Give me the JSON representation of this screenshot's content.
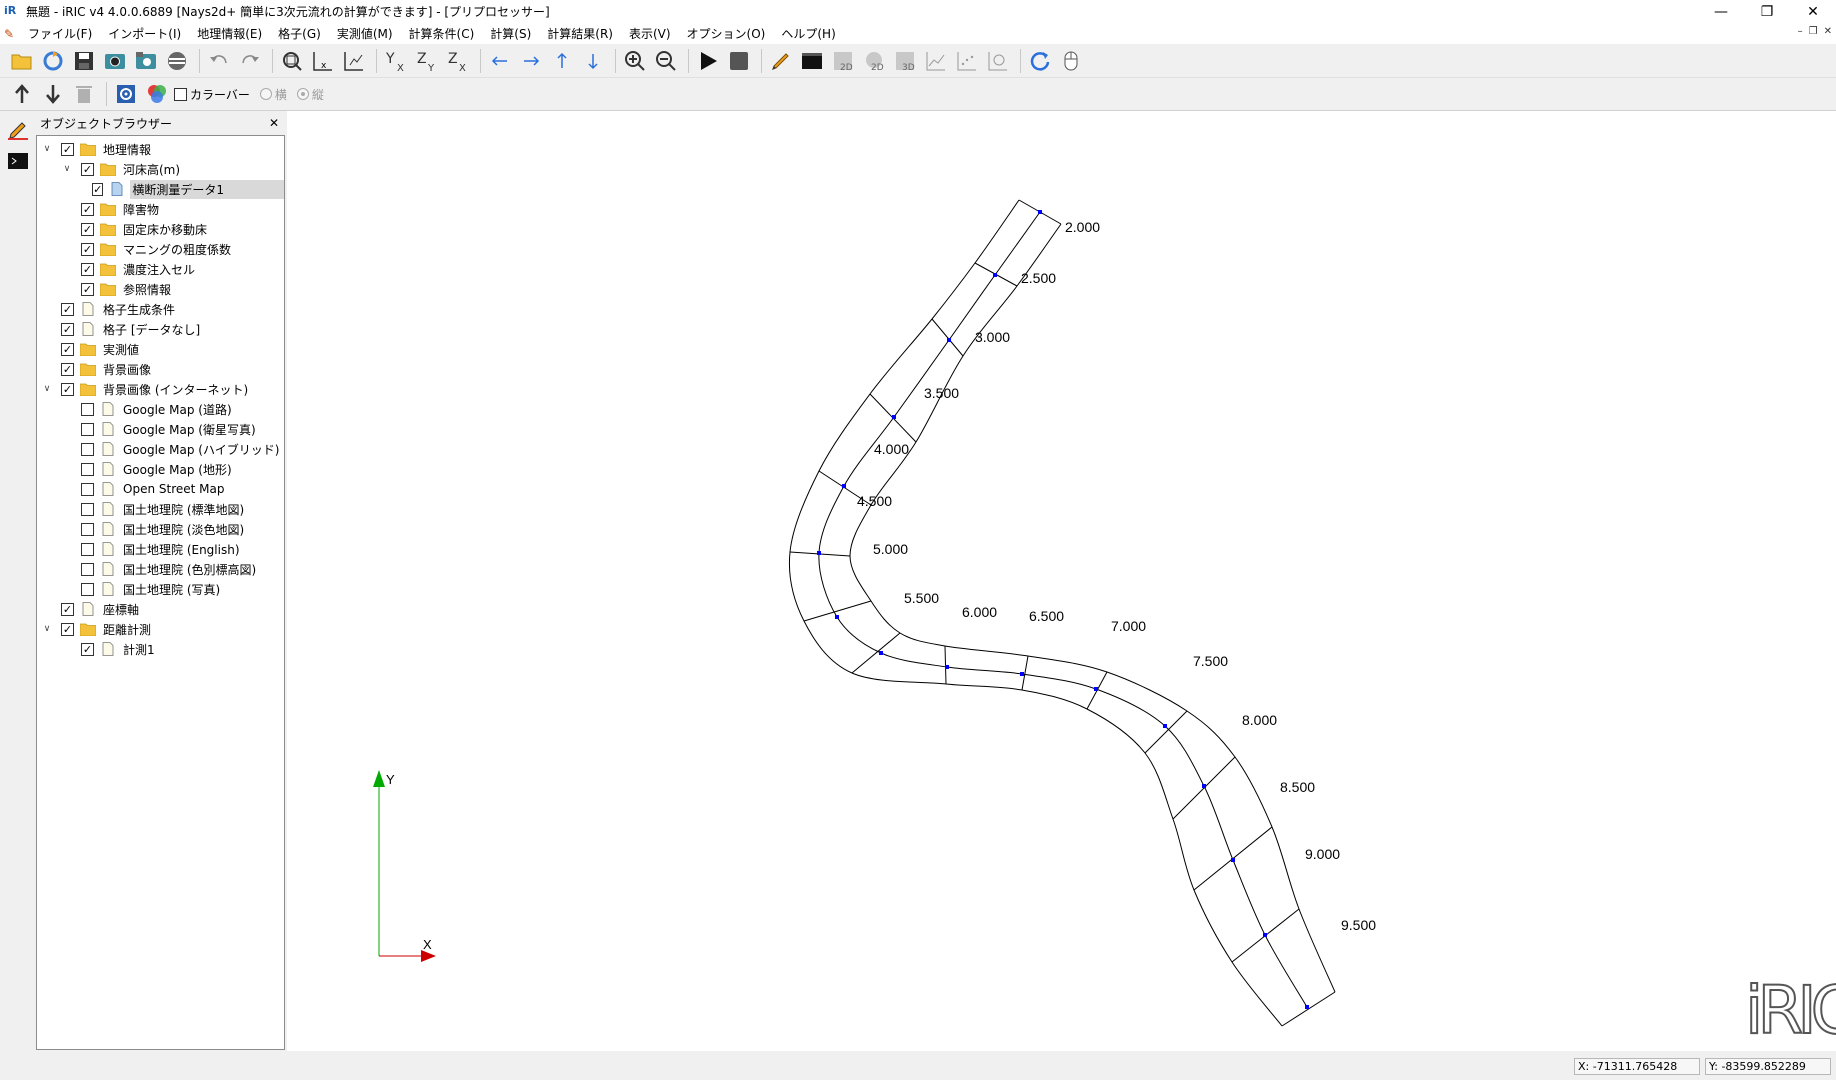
{
  "window": {
    "title": "無題 - iRIC v4 4.0.0.6889 [Nays2d+ 簡単に3次元流れの計算ができます] - [プリプロセッサー]",
    "app_icon_text": "iR"
  },
  "menu": {
    "items": [
      "ファイル(F)",
      "インポート(I)",
      "地理情報(E)",
      "格子(G)",
      "実測値(M)",
      "計算条件(C)",
      "計算(S)",
      "計算結果(R)",
      "表示(V)",
      "オプション(O)",
      "ヘルプ(H)"
    ]
  },
  "toolbar2": {
    "colorbar_label": "カラーバー",
    "horizontal_label": "横",
    "vertical_label": "縦"
  },
  "object_browser": {
    "title": "オブジェクトブラウザー",
    "items": [
      {
        "label": "地理情報",
        "level": 0,
        "expanded": true,
        "checked": true,
        "icon": "folder-icon"
      },
      {
        "label": "河床高(m)",
        "level": 1,
        "expanded": true,
        "checked": true,
        "icon": "folder-icon"
      },
      {
        "label": "横断測量データ1",
        "level": 2,
        "checked": true,
        "icon": "data-file-icon",
        "selected": true
      },
      {
        "label": "障害物",
        "level": 1,
        "checked": true,
        "icon": "folder-icon"
      },
      {
        "label": "固定床か移動床",
        "level": 1,
        "checked": true,
        "icon": "folder-icon"
      },
      {
        "label": "マニングの粗度係数",
        "level": 1,
        "checked": true,
        "icon": "folder-icon"
      },
      {
        "label": "濃度注入セル",
        "level": 1,
        "checked": true,
        "icon": "folder-icon"
      },
      {
        "label": "参照情報",
        "level": 1,
        "checked": true,
        "icon": "folder-icon"
      },
      {
        "label": "格子生成条件",
        "level": 0,
        "checked": true,
        "icon": "file-icon"
      },
      {
        "label": "格子 [データなし]",
        "level": 0,
        "checked": true,
        "icon": "file-icon"
      },
      {
        "label": "実測値",
        "level": 0,
        "checked": true,
        "icon": "folder-icon"
      },
      {
        "label": "背景画像",
        "level": 0,
        "checked": true,
        "icon": "folder-icon"
      },
      {
        "label": "背景画像 (インターネット)",
        "level": 0,
        "expanded": true,
        "checked": true,
        "icon": "folder-icon"
      },
      {
        "label": "Google Map (道路)",
        "level": 1,
        "checked": false,
        "icon": "file-icon"
      },
      {
        "label": "Google Map (衛星写真)",
        "level": 1,
        "checked": false,
        "icon": "file-icon"
      },
      {
        "label": "Google Map (ハイブリッド)",
        "level": 1,
        "checked": false,
        "icon": "file-icon"
      },
      {
        "label": "Google Map (地形)",
        "level": 1,
        "checked": false,
        "icon": "file-icon"
      },
      {
        "label": "Open Street Map",
        "level": 1,
        "checked": false,
        "icon": "file-icon"
      },
      {
        "label": "国土地理院 (標準地図)",
        "level": 1,
        "checked": false,
        "icon": "file-icon"
      },
      {
        "label": "国土地理院 (淡色地図)",
        "level": 1,
        "checked": false,
        "icon": "file-icon"
      },
      {
        "label": "国土地理院 (English)",
        "level": 1,
        "checked": false,
        "icon": "file-icon"
      },
      {
        "label": "国土地理院 (色別標高図)",
        "level": 1,
        "checked": false,
        "icon": "file-icon"
      },
      {
        "label": "国土地理院 (写真)",
        "level": 1,
        "checked": false,
        "icon": "file-icon"
      },
      {
        "label": "座標軸",
        "level": 0,
        "checked": true,
        "icon": "file-icon"
      },
      {
        "label": "距離計測",
        "level": 0,
        "expanded": true,
        "checked": true,
        "icon": "folder-icon"
      },
      {
        "label": "計測1",
        "level": 1,
        "checked": true,
        "icon": "file-icon"
      }
    ]
  },
  "canvas": {
    "cross_section_labels": [
      "2.000",
      "2.500",
      "3.000",
      "3.500",
      "4.000",
      "4.500",
      "5.000",
      "5.500",
      "6.000",
      "6.500",
      "7.000",
      "7.500",
      "8.000",
      "8.500",
      "9.000",
      "9.500"
    ],
    "axis_x_label": "X",
    "axis_y_label": "Y",
    "logo_text": "iRIC",
    "colors": {
      "centerline_point": "#0000ff",
      "axis_x": "#cc0000",
      "axis_y": "#00aa00",
      "river_line": "#000000"
    }
  },
  "status": {
    "x_coord": "X: -71311.765428",
    "y_coord": "Y: -83599.852289"
  }
}
